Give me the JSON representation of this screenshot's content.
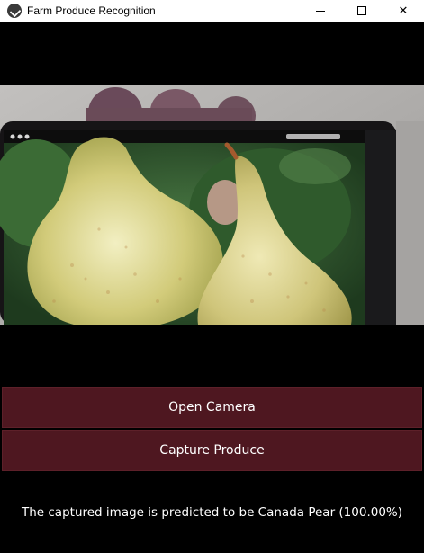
{
  "window": {
    "title": "Farm Produce Recognition",
    "app_icon": "kivy-logo-icon",
    "controls": [
      "minimize-icon",
      "maximize-icon",
      "close-icon"
    ],
    "close_glyph": "✕"
  },
  "camera": {
    "description_icon": "camera-preview-image"
  },
  "buttons": {
    "open_camera": "Open Camera",
    "capture_produce": "Capture Produce"
  },
  "result": {
    "text": "The captured image is predicted to be Canada Pear (100.00%)"
  },
  "colors": {
    "background": "#000000",
    "button_bg": "#4e1720",
    "button_text": "#ffffff",
    "titlebar_bg": "#ffffff"
  }
}
